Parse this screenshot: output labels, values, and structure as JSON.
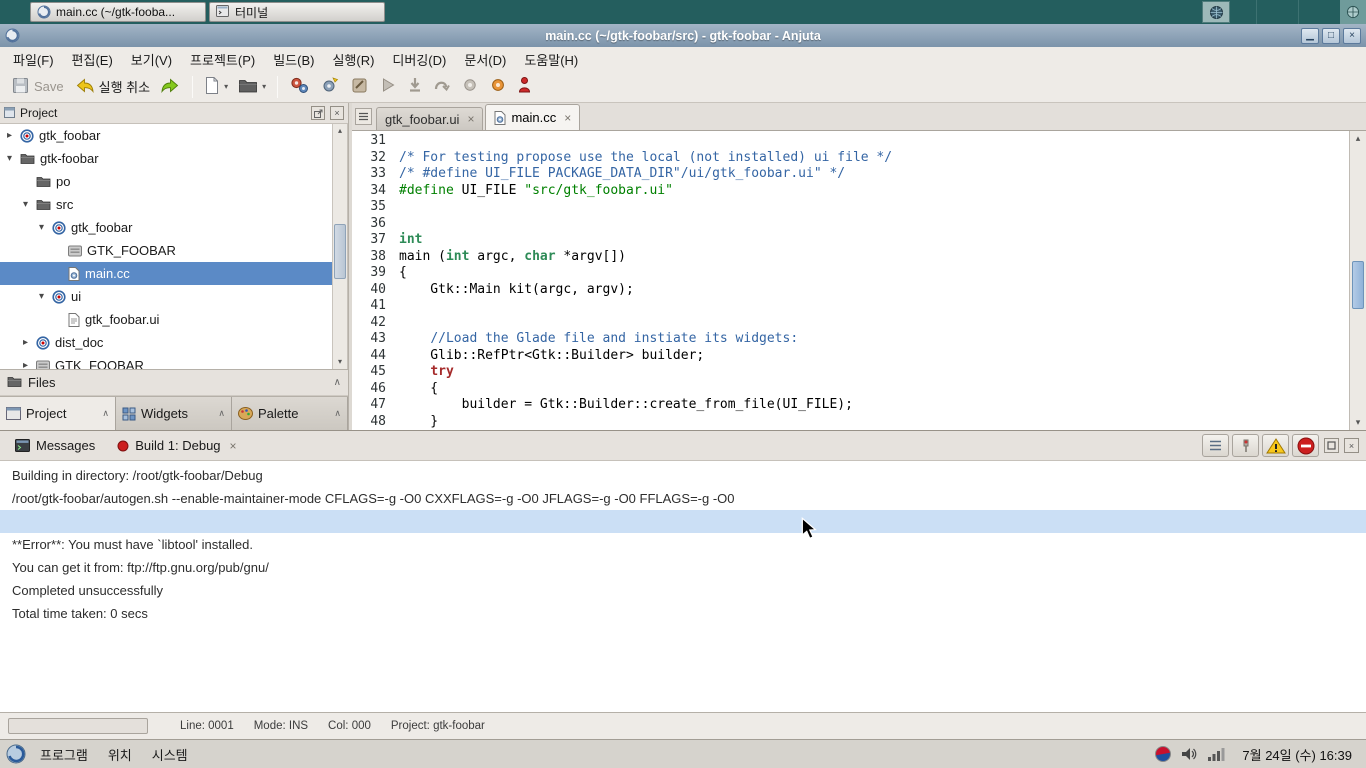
{
  "os_taskbar": {
    "windows": [
      {
        "label": "main.cc (~/gtk-fooba...",
        "icon": "anjuta-icon"
      },
      {
        "label": "터미널",
        "icon": "terminal-icon"
      }
    ]
  },
  "window": {
    "title": "main.cc (~/gtk-foobar/src) - gtk-foobar - Anjuta",
    "controls": {
      "minimize": "▁",
      "maximize": "□",
      "close": "×"
    }
  },
  "menubar": {
    "items": [
      "파일(F)",
      "편집(E)",
      "보기(V)",
      "프로젝트(P)",
      "빌드(B)",
      "실행(R)",
      "디버깅(D)",
      "문서(D)",
      "도움말(H)"
    ]
  },
  "toolbar": {
    "save_label": "Save",
    "undo_label": "실행 취소"
  },
  "project_panel": {
    "header": "Project",
    "files_header": "Files",
    "tabs": [
      {
        "label": "Project",
        "icon": "project-icon",
        "active": true
      },
      {
        "label": "Widgets",
        "icon": "widgets-icon",
        "active": false
      },
      {
        "label": "Palette",
        "icon": "palette-icon",
        "active": false
      }
    ],
    "tree": [
      {
        "label": "gtk_foobar",
        "depth": 0,
        "expander": "collapsed",
        "icon": "target-icon",
        "selected": false
      },
      {
        "label": "gtk-foobar",
        "depth": 0,
        "expander": "expanded",
        "icon": "folder-icon",
        "selected": false
      },
      {
        "label": "po",
        "depth": 1,
        "expander": "none",
        "icon": "folder-icon",
        "selected": false
      },
      {
        "label": "src",
        "depth": 1,
        "expander": "expanded",
        "icon": "folder-icon",
        "selected": false
      },
      {
        "label": "gtk_foobar",
        "depth": 2,
        "expander": "expanded",
        "icon": "target-icon",
        "selected": false
      },
      {
        "label": "GTK_FOOBAR",
        "depth": 3,
        "expander": "none",
        "icon": "macro-icon",
        "selected": false
      },
      {
        "label": "main.cc",
        "depth": 3,
        "expander": "none",
        "icon": "source-icon",
        "selected": true
      },
      {
        "label": "ui",
        "depth": 2,
        "expander": "expanded",
        "icon": "target-icon",
        "selected": false
      },
      {
        "label": "gtk_foobar.ui",
        "depth": 3,
        "expander": "none",
        "icon": "file-icon",
        "selected": false
      },
      {
        "label": "dist_doc",
        "depth": 1,
        "expander": "collapsed",
        "icon": "target-icon",
        "selected": false
      },
      {
        "label": "GTK_FOOBAR",
        "depth": 1,
        "expander": "collapsed",
        "icon": "macro-icon",
        "selected": false
      }
    ]
  },
  "editor": {
    "tabs": [
      {
        "label": "gtk_foobar.ui",
        "active": false,
        "icon": null
      },
      {
        "label": "main.cc",
        "active": true,
        "icon": "source-icon"
      }
    ],
    "lines": [
      {
        "no": "31",
        "segs": []
      },
      {
        "no": "32",
        "segs": [
          [
            "comment",
            "/* For testing propose use the local (not installed) ui file */"
          ]
        ]
      },
      {
        "no": "33",
        "segs": [
          [
            "comment",
            "/* #define UI_FILE PACKAGE_DATA_DIR\"/ui/gtk_foobar.ui\" */"
          ]
        ]
      },
      {
        "no": "34",
        "segs": [
          [
            "preproc",
            "#define"
          ],
          [
            "plain",
            " UI_FILE "
          ],
          [
            "string",
            "\"src/gtk_foobar.ui\""
          ]
        ]
      },
      {
        "no": "35",
        "segs": []
      },
      {
        "no": "36",
        "segs": []
      },
      {
        "no": "37",
        "segs": [
          [
            "type",
            "int"
          ]
        ]
      },
      {
        "no": "38",
        "segs": [
          [
            "plain",
            "main ("
          ],
          [
            "type",
            "int"
          ],
          [
            "plain",
            " argc, "
          ],
          [
            "type",
            "char"
          ],
          [
            "plain",
            " *argv[])"
          ]
        ]
      },
      {
        "no": "39",
        "segs": [
          [
            "plain",
            "{"
          ]
        ]
      },
      {
        "no": "40",
        "segs": [
          [
            "plain",
            "    Gtk::Main kit(argc, argv);"
          ]
        ]
      },
      {
        "no": "41",
        "segs": []
      },
      {
        "no": "42",
        "segs": []
      },
      {
        "no": "43",
        "segs": [
          [
            "plain",
            "    "
          ],
          [
            "comment",
            "//Load the Glade file and instiate its widgets:"
          ]
        ]
      },
      {
        "no": "44",
        "segs": [
          [
            "plain",
            "    Glib::RefPtr<Gtk::Builder> builder;"
          ]
        ]
      },
      {
        "no": "45",
        "segs": [
          [
            "plain",
            "    "
          ],
          [
            "keyword",
            "try"
          ]
        ]
      },
      {
        "no": "46",
        "segs": [
          [
            "plain",
            "    {"
          ]
        ]
      },
      {
        "no": "47",
        "segs": [
          [
            "plain",
            "        builder = Gtk::Builder::create_from_file(UI_FILE);"
          ]
        ]
      },
      {
        "no": "48",
        "segs": [
          [
            "plain",
            "    }"
          ]
        ]
      }
    ]
  },
  "messages_panel": {
    "tabs": [
      {
        "label": "Messages",
        "icon": "messages-icon",
        "closable": false
      },
      {
        "label": "Build 1: Debug",
        "icon": "build-status-icon",
        "closable": true
      }
    ],
    "lines": [
      {
        "text": "Building in directory: /root/gtk-foobar/Debug",
        "selected": false
      },
      {
        "text": "/root/gtk-foobar/autogen.sh --enable-maintainer-mode CFLAGS=-g -O0 CXXFLAGS=-g -O0 JFLAGS=-g -O0 FFLAGS=-g -O0",
        "selected": false
      },
      {
        "text": "",
        "selected": true
      },
      {
        "text": "**Error**: You must have `libtool' installed.",
        "selected": false
      },
      {
        "text": "You can get it from: ftp://ftp.gnu.org/pub/gnu/",
        "selected": false
      },
      {
        "text": "Completed unsuccessfully",
        "selected": false
      },
      {
        "text": "Total time taken: 0 secs",
        "selected": false
      }
    ]
  },
  "statusbar": {
    "line": "Line: 0001",
    "mode": "Mode: INS",
    "col": "Col: 000",
    "project": "Project: gtk-foobar"
  },
  "desktop_taskbar": {
    "menus": [
      "프로그램",
      "위치",
      "시스템"
    ],
    "clock": "7월 24일 (수) 16:39"
  },
  "colors": {
    "selection_blue": "#5b8ac6",
    "teal_bar": "#245e5e",
    "comment": "#3465a4",
    "type": "#2e8b57",
    "keyword": "#a52a2a",
    "preproc": "#008000",
    "string": "#008000"
  }
}
